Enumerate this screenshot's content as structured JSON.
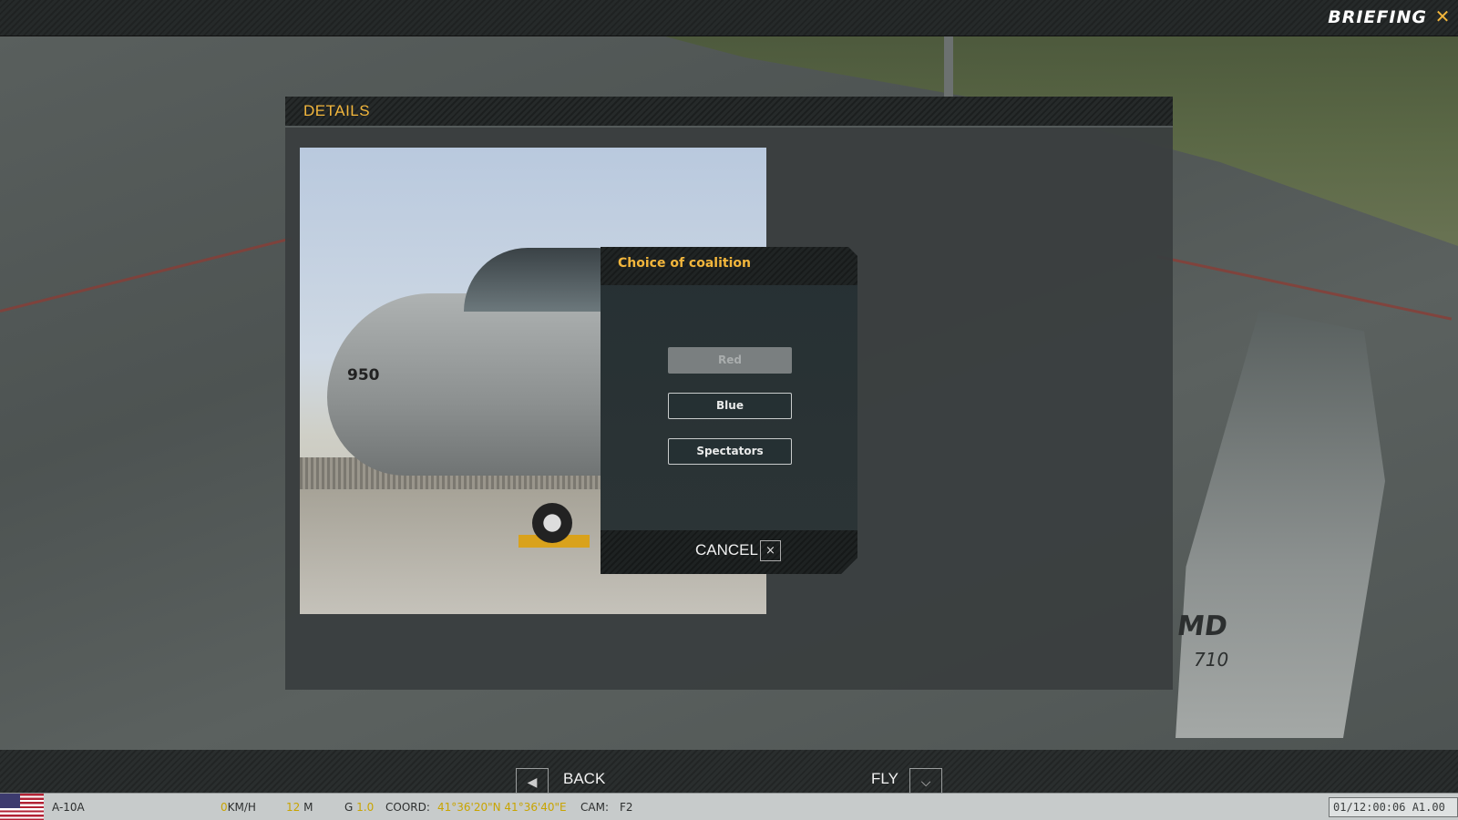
{
  "top_bar": {
    "title": "BRIEFING",
    "close_icon": "close-icon"
  },
  "details": {
    "header": "DETAILS",
    "photo_label": "950",
    "tail_text": "MD",
    "tail_number": "710"
  },
  "dialog": {
    "title": "Choice of coalition",
    "buttons": [
      {
        "label": "Red",
        "enabled": false
      },
      {
        "label": "Blue",
        "enabled": true
      },
      {
        "label": "Spectators",
        "enabled": true
      }
    ],
    "cancel_label": "CANCEL",
    "cancel_icon": "×"
  },
  "bottom_nav": {
    "back_label": "BACK",
    "back_icon": "◀",
    "fly_label": "FLY",
    "fly_icon": "⌵"
  },
  "status": {
    "aircraft": "A-10A",
    "speed_value": "0",
    "speed_unit": "KM/H",
    "altitude_value": "12",
    "altitude_unit": "M",
    "g_label": "G",
    "g_value": "1.0",
    "coord_label": "COORD:",
    "coord_value": "41°36'20\"N 41°36'40\"E",
    "cam_label": "CAM:",
    "cam_value": "F2",
    "time": "01/12:00:06 A1.00"
  },
  "colors": {
    "accent": "#f2b63c",
    "panel": "#3a3e3f",
    "status_value": "#c8a400"
  }
}
